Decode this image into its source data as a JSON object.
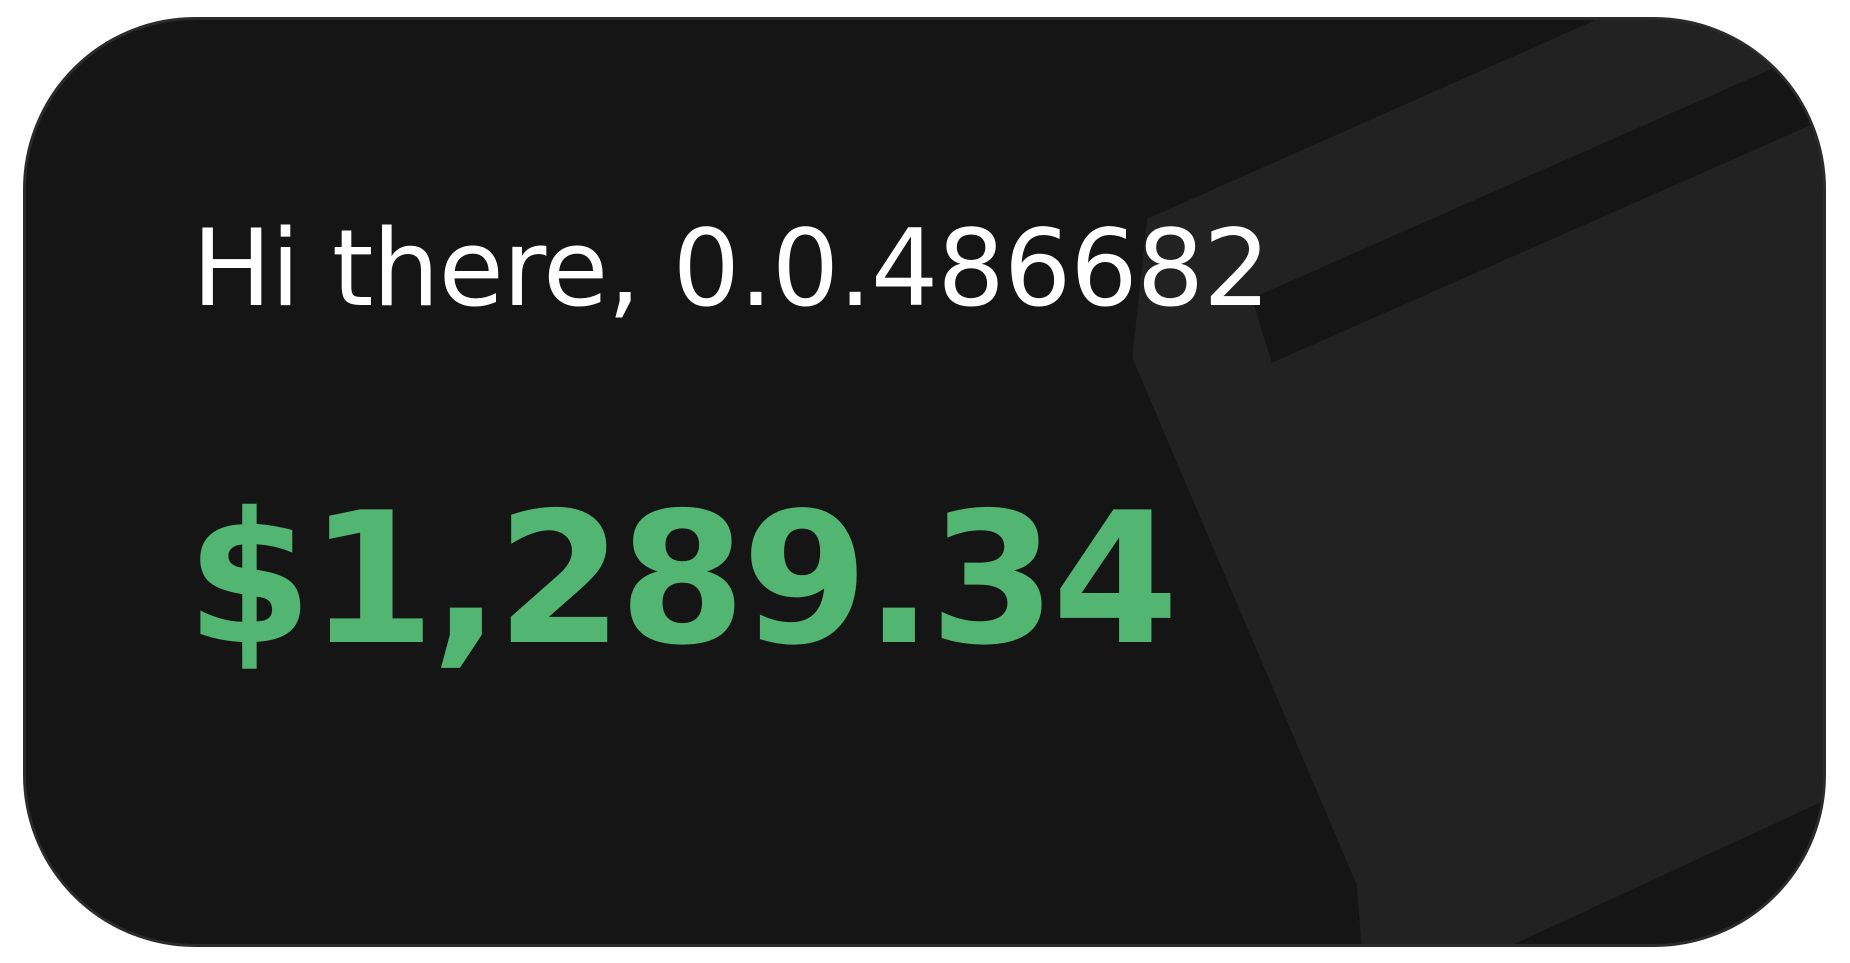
{
  "wallet": {
    "greeting": "Hi there, 0.0.486682",
    "balance": "$1,289.34"
  },
  "colors": {
    "card_background": "#151515",
    "card_border": "#2b2b2b",
    "decor_shape": "#222222",
    "balance_text": "#52b572",
    "greeting_text": "#ffffff"
  }
}
